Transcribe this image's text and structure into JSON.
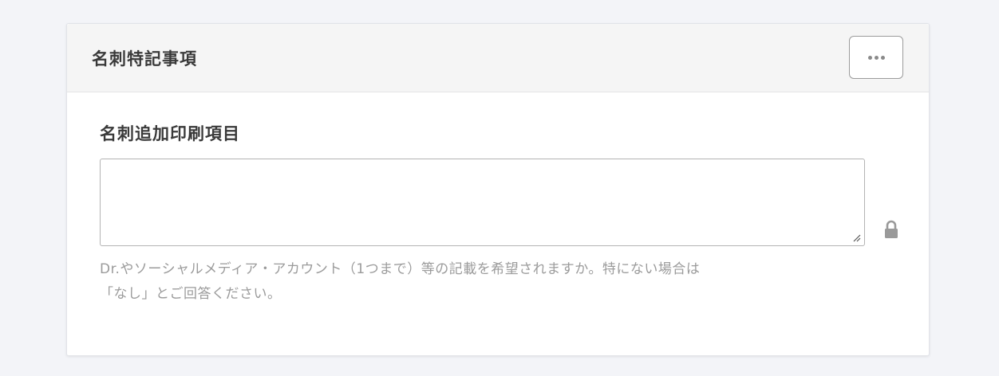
{
  "card": {
    "title": "名刺特記事項",
    "more_button_icon": "more-horizontal-icon"
  },
  "field": {
    "label": "名刺追加印刷項目",
    "value": "",
    "placeholder": "",
    "lock_icon": "lock-icon",
    "help_line1": "Dr.やソーシャルメディア・アカウント（1つまで）等の記載を希望されますか。特にない場合は",
    "help_line2": "「なし」とご回答ください。"
  },
  "colors": {
    "page_background": "#f3f4f8",
    "card_background": "#ffffff",
    "header_background": "#f5f5f5",
    "text_primary": "#3a3a3a",
    "text_muted": "#9b9b9b"
  }
}
